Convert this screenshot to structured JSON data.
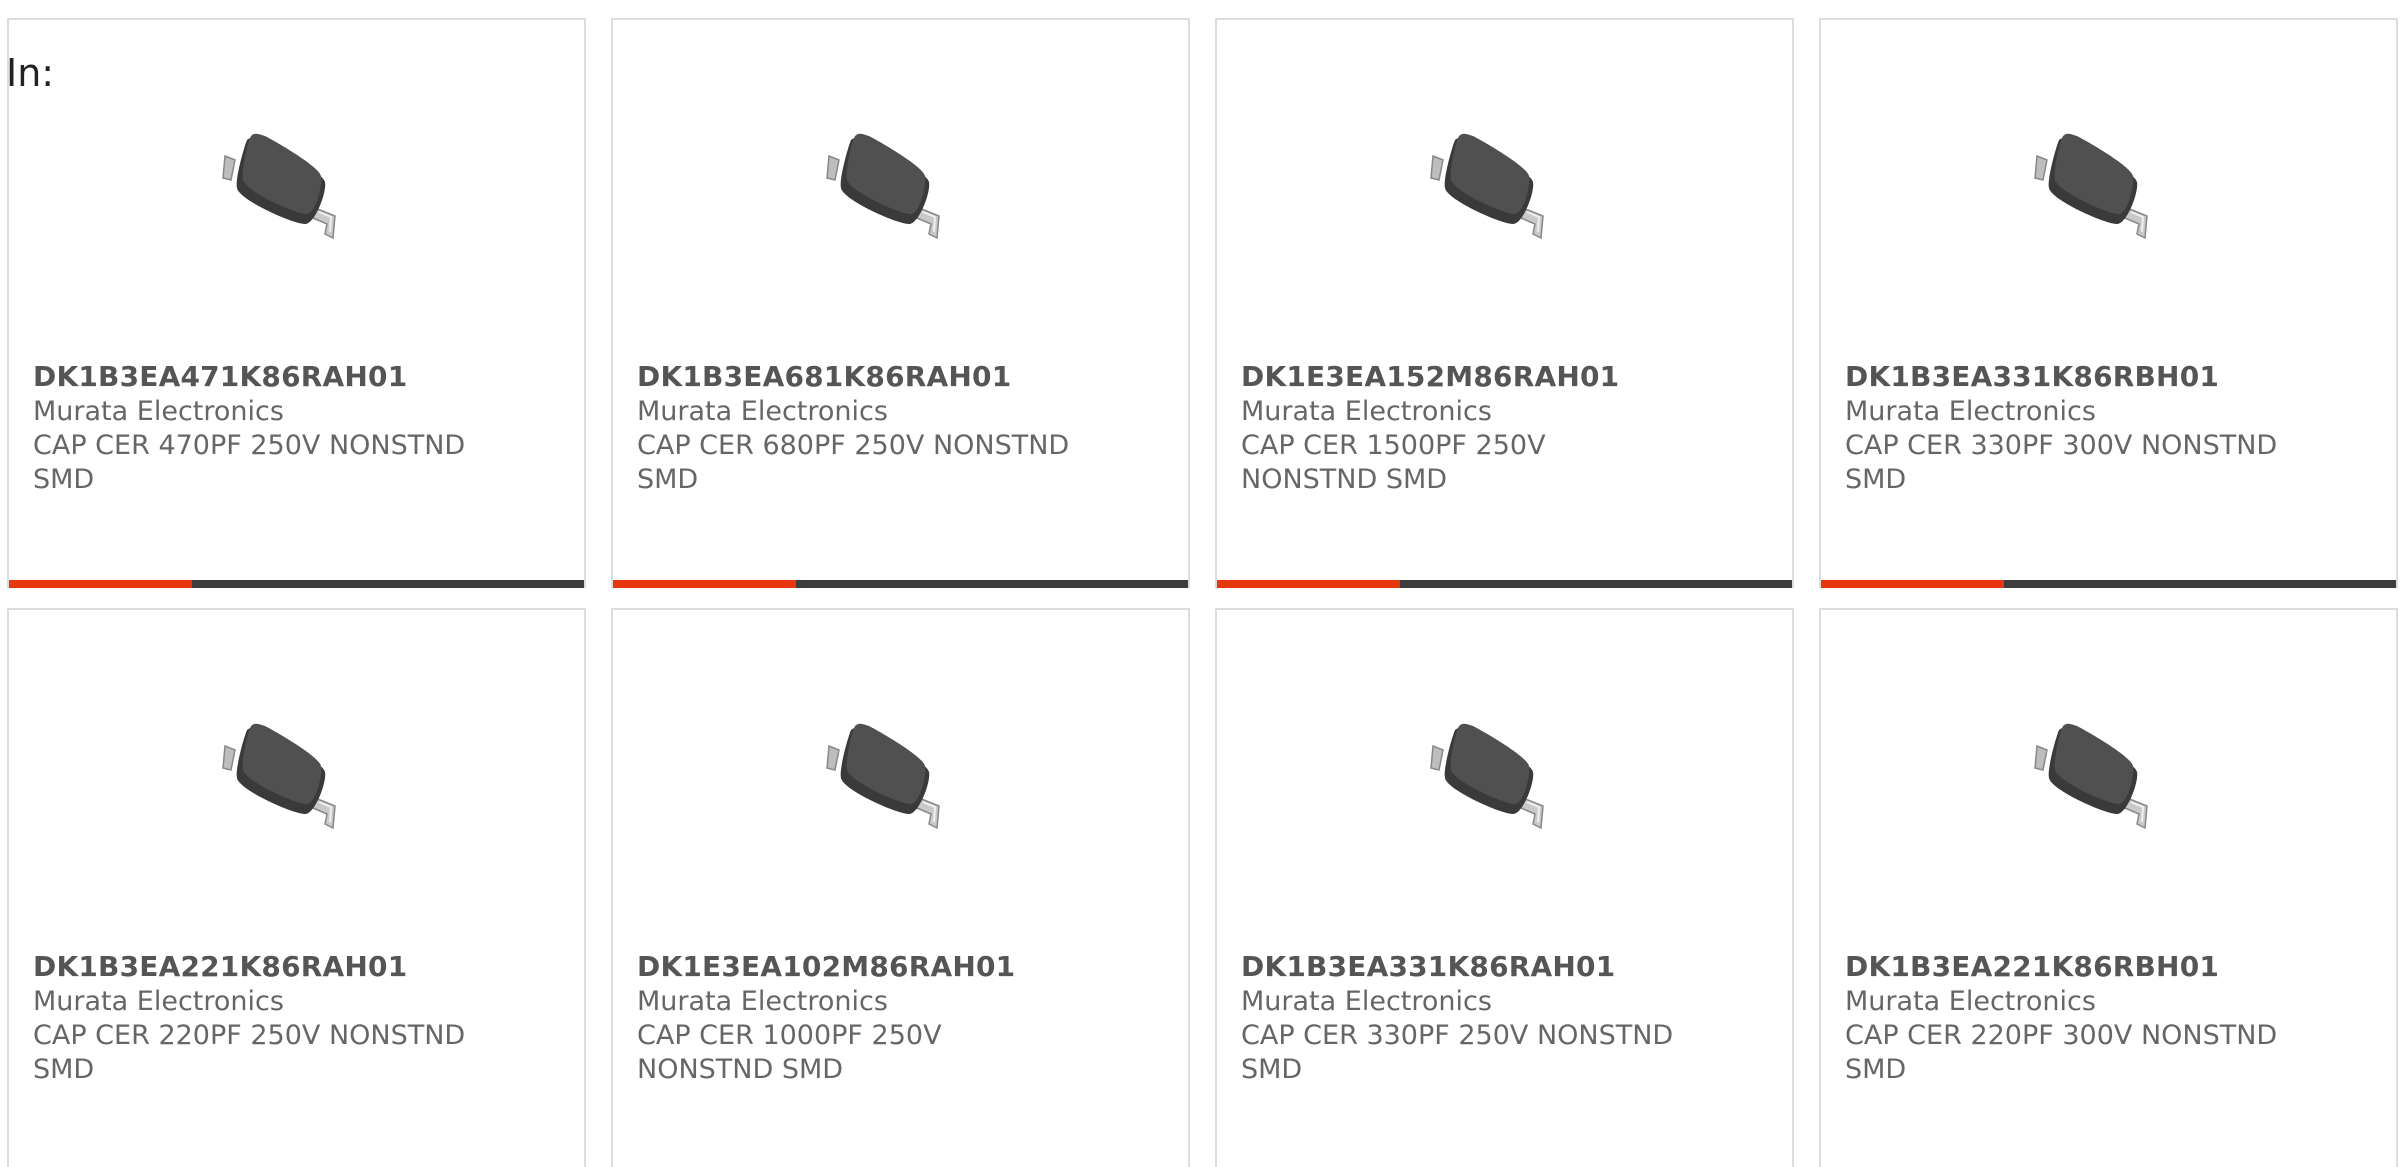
{
  "filter": {
    "label": "In:"
  },
  "colors": {
    "accent": "#e8360f",
    "bar": "#3d3d3d",
    "border": "#dcdcdc",
    "text": "#666666"
  },
  "products": [
    {
      "part_number": "DK1B3EA471K86RAH01",
      "manufacturer": "Murata Electronics",
      "description": "CAP CER 470PF 250V NONSTND SMD",
      "image_icon": "smd-capacitor-icon"
    },
    {
      "part_number": "DK1B3EA681K86RAH01",
      "manufacturer": "Murata Electronics",
      "description": "CAP CER 680PF 250V NONSTND SMD",
      "image_icon": "smd-capacitor-icon"
    },
    {
      "part_number": "DK1E3EA152M86RAH01",
      "manufacturer": "Murata Electronics",
      "description": "CAP CER 1500PF 250V NONSTND SMD",
      "image_icon": "smd-capacitor-icon"
    },
    {
      "part_number": "DK1B3EA331K86RBH01",
      "manufacturer": "Murata Electronics",
      "description": "CAP CER 330PF 300V NONSTND SMD",
      "image_icon": "smd-capacitor-icon"
    },
    {
      "part_number": "DK1B3EA221K86RAH01",
      "manufacturer": "Murata Electronics",
      "description": "CAP CER 220PF 250V NONSTND SMD",
      "image_icon": "smd-capacitor-icon"
    },
    {
      "part_number": "DK1E3EA102M86RAH01",
      "manufacturer": "Murata Electronics",
      "description": "CAP CER 1000PF 250V NONSTND SMD",
      "image_icon": "smd-capacitor-icon"
    },
    {
      "part_number": "DK1B3EA331K86RAH01",
      "manufacturer": "Murata Electronics",
      "description": "CAP CER 330PF 250V NONSTND SMD",
      "image_icon": "smd-capacitor-icon"
    },
    {
      "part_number": "DK1B3EA221K86RBH01",
      "manufacturer": "Murata Electronics",
      "description": "CAP CER 220PF 300V NONSTND SMD",
      "image_icon": "smd-capacitor-icon"
    }
  ]
}
